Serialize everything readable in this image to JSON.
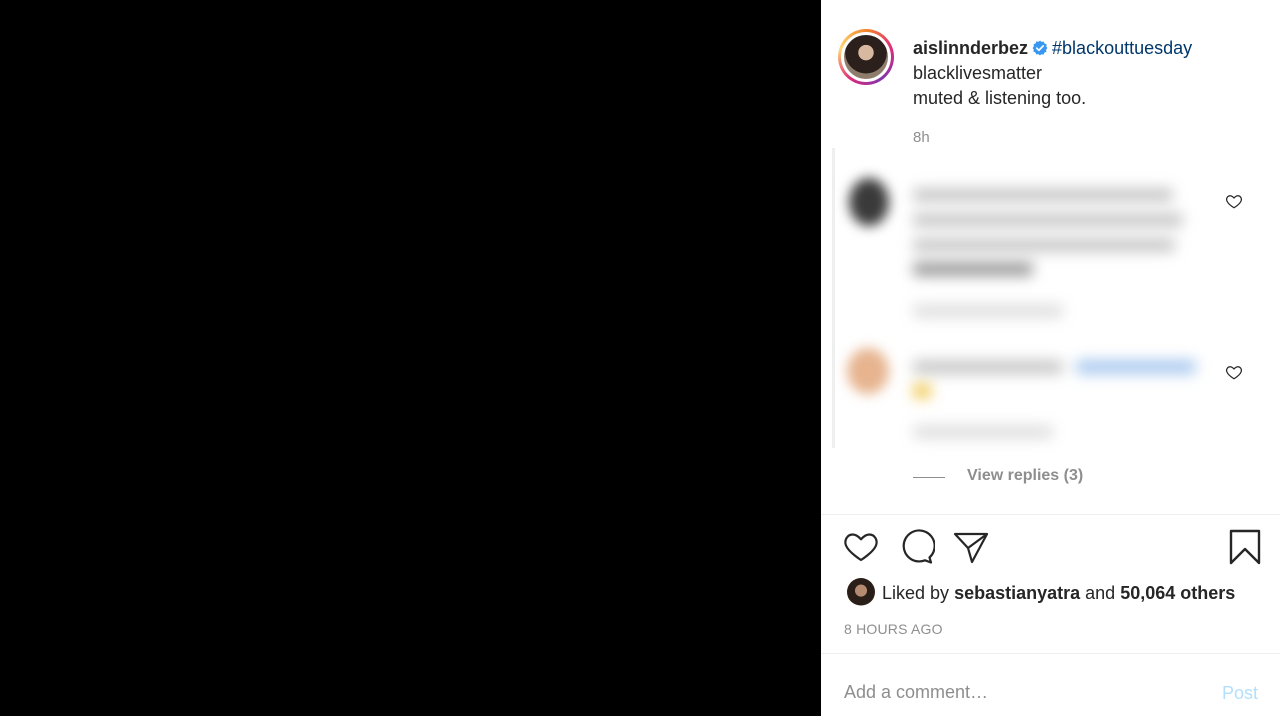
{
  "post": {
    "username": "aislinnderbez",
    "hashtag": "#blackouttuesday",
    "caption_line2": "blacklivesmatter",
    "caption_line3": "muted & listening too.",
    "age": "8h"
  },
  "icons": {
    "verified": "verified-badge-icon",
    "like": "heart-icon",
    "comment": "comment-icon",
    "share": "paper-plane-icon",
    "save": "bookmark-icon"
  },
  "comments": {
    "view_replies": "View replies (3)"
  },
  "likes": {
    "prefix": "Liked by",
    "user": "sebastianyatra",
    "conjunction": "and",
    "others": "50,064 others"
  },
  "timestamp": "8 HOURS AGO",
  "comment_box": {
    "placeholder": "Add a comment…",
    "post_label": "Post"
  },
  "colors": {
    "verified": "#3897f0",
    "hashtag": "#00376b",
    "post_disabled": "#b2dffc"
  }
}
